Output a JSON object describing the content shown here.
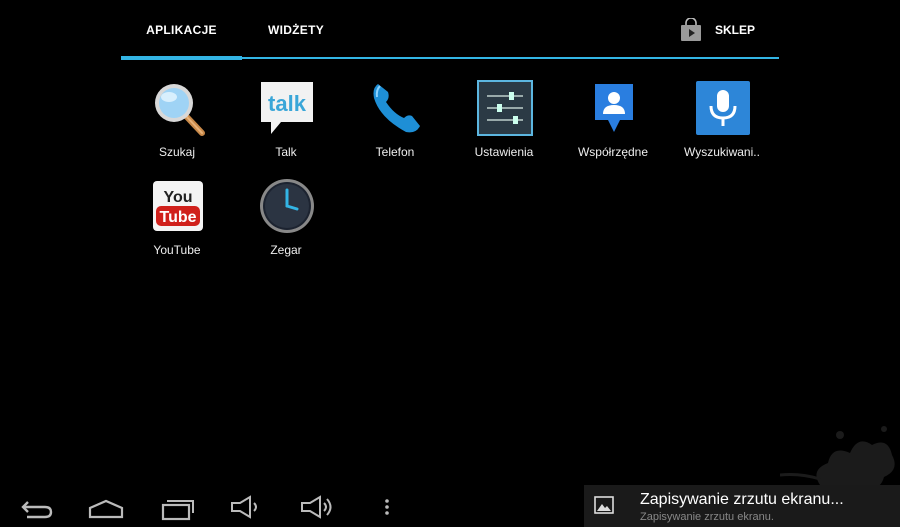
{
  "tabs": {
    "apps": "APLIKACJE",
    "widgets": "WIDŻETY",
    "store": "SKLEP"
  },
  "apps": [
    {
      "name": "Szukaj",
      "icon": "magnifier-icon"
    },
    {
      "name": "Talk",
      "icon": "talk-icon",
      "badge": "talk"
    },
    {
      "name": "Telefon",
      "icon": "phone-icon"
    },
    {
      "name": "Ustawienia",
      "icon": "settings-sliders-icon"
    },
    {
      "name": "Współrzędne",
      "icon": "latitude-pin-icon"
    },
    {
      "name": "Wyszukiwani..",
      "icon": "voice-search-mic-icon"
    },
    {
      "name": "YouTube",
      "icon": "youtube-icon",
      "badge_top": "You",
      "badge_bottom": "Tube"
    },
    {
      "name": "Zegar",
      "icon": "clock-icon"
    }
  ],
  "notification": {
    "title": "Zapisywanie zrzutu ekranu...",
    "subtitle": "Zapisywanie zrzutu ekranu."
  },
  "colors": {
    "accent": "#33b5e5",
    "background": "#000000"
  }
}
